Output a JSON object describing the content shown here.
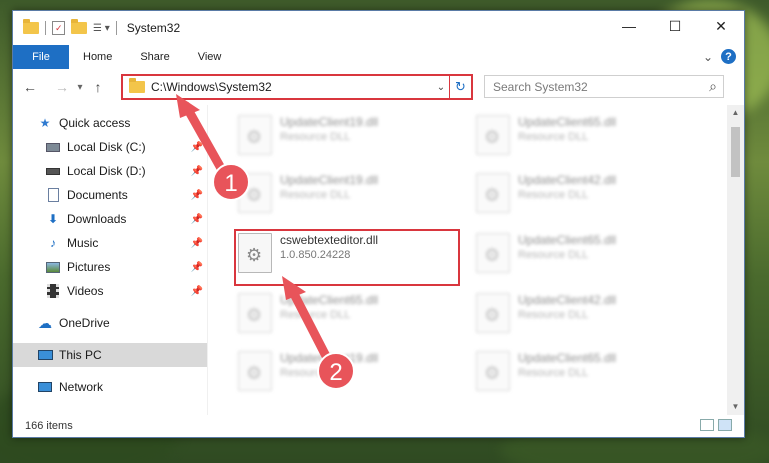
{
  "window": {
    "title": "System32"
  },
  "controls": {
    "minimize": "—",
    "maximize": "☐",
    "close": "✕"
  },
  "ribbon": {
    "tabs": [
      "File",
      "Home",
      "Share",
      "View"
    ],
    "expand": "⌄",
    "help": "?"
  },
  "address": {
    "back": "←",
    "forward": "→",
    "recent": "▾",
    "up": "↑",
    "path": "C:\\Windows\\System32",
    "dropdown": "⌄",
    "refresh": "↻"
  },
  "search": {
    "placeholder": "Search System32",
    "icon": "⌕"
  },
  "sidebar": {
    "quick_access": "Quick access",
    "pinned": [
      {
        "label": "Local Disk (C:)",
        "icon": "disk-icon"
      },
      {
        "label": "Local Disk (D:)",
        "icon": "disk-icon"
      },
      {
        "label": "Documents",
        "icon": "documents-icon"
      },
      {
        "label": "Downloads",
        "icon": "downloads-icon"
      },
      {
        "label": "Music",
        "icon": "music-icon"
      },
      {
        "label": "Pictures",
        "icon": "pictures-icon"
      },
      {
        "label": "Videos",
        "icon": "videos-icon"
      }
    ],
    "onedrive": "OneDrive",
    "thispc": "This PC",
    "network": "Network"
  },
  "files": {
    "left": [
      {
        "name": "UpdateClient19.dll",
        "desc": "Resource DLL"
      },
      {
        "name": "UpdateClient19.dll",
        "desc": "Resource DLL"
      },
      {
        "name": "cswebtexteditor.dll",
        "desc": "1.0.850.24228"
      },
      {
        "name": "UpdateClient65.dll",
        "desc": "Resource DLL"
      },
      {
        "name": "UpdateClient19.dll",
        "desc": "Resource DLL"
      }
    ],
    "right": [
      {
        "name": "UpdateClient65.dll",
        "desc": "Resource DLL"
      },
      {
        "name": "UpdateClient42.dll",
        "desc": "Resource DLL"
      },
      {
        "name": "UpdateClient65.dll",
        "desc": "Resource DLL"
      },
      {
        "name": "UpdateClient42.dll",
        "desc": "Resource DLL"
      },
      {
        "name": "UpdateClient65.dll",
        "desc": "Resource DLL"
      }
    ]
  },
  "status": {
    "count": "166 items"
  },
  "annotations": {
    "step1": "1",
    "step2": "2"
  },
  "colors": {
    "accent": "#1e6fc4",
    "highlight": "#d9363e",
    "arrow": "#e8545a"
  }
}
